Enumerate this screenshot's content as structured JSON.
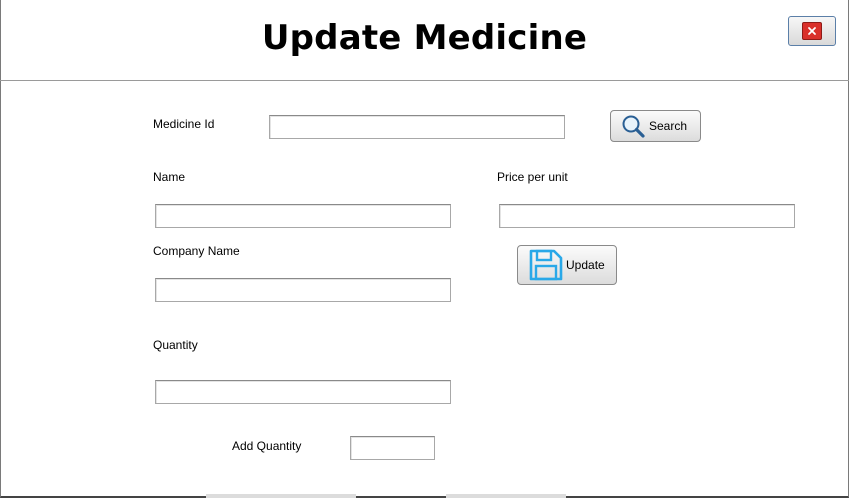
{
  "window": {
    "title": "Update Medicine",
    "close_label": "×"
  },
  "form": {
    "medicine_id_label": "Medicine Id",
    "medicine_id_value": "",
    "search_label": "Search",
    "name_label": "Name",
    "name_value": "",
    "price_label": "Price per unit",
    "price_value": "",
    "company_label": "Company Name",
    "company_value": "",
    "update_label": "Update",
    "quantity_label": "Quantity",
    "quantity_value": "",
    "add_quantity_label": "Add Quantity",
    "add_quantity_value": ""
  },
  "colors": {
    "close_red": "#d9302a",
    "save_icon_blue": "#29a8e8"
  }
}
